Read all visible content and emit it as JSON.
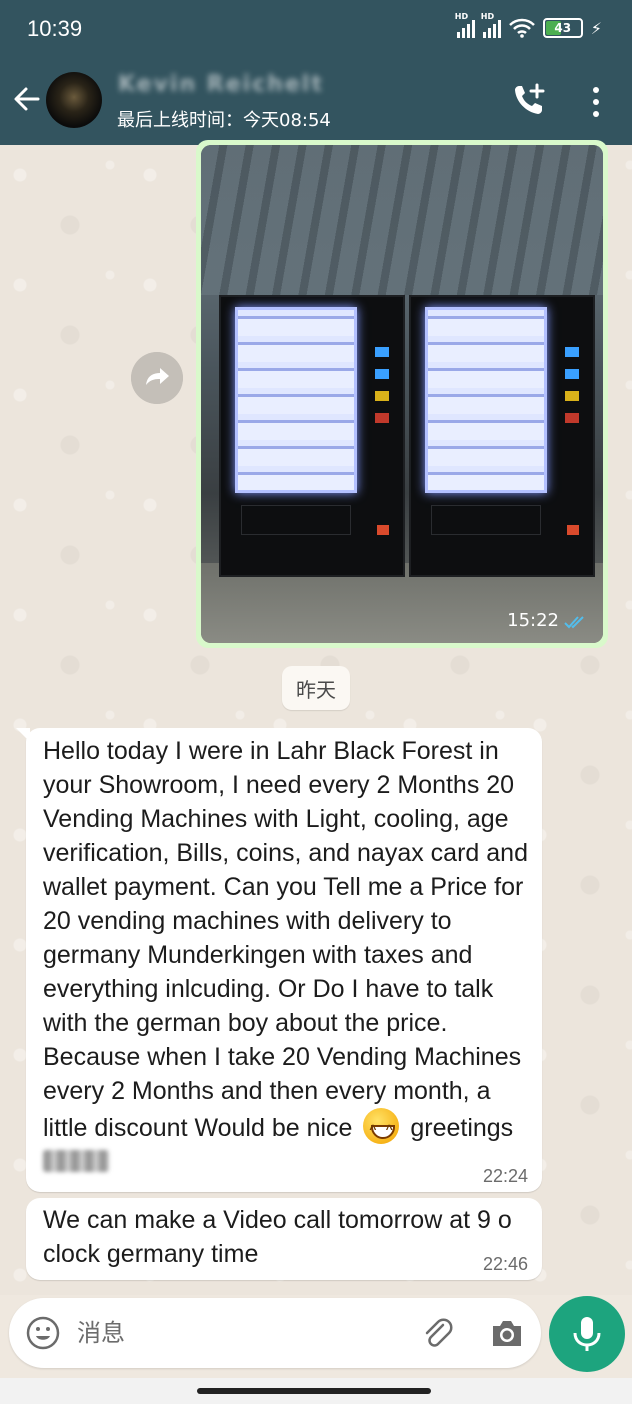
{
  "status_bar": {
    "time": "10:39",
    "signal_1_label": "HD",
    "signal_2_label": "HD",
    "battery_level": "43",
    "battery_fraction": 0.43
  },
  "header": {
    "contact_name": "Kevin Reichelt",
    "last_seen": "最后上线时间：今天08:54",
    "icons": [
      "back-arrow-icon",
      "add-call-icon",
      "more-vertical-icon"
    ]
  },
  "messages": {
    "image_message": {
      "time": "15:22",
      "status": "read"
    },
    "date_divider": "昨天",
    "message_1": {
      "text": "Hello today I were in Lahr Black Forest in your Showroom, I need every 2 Months 20 Vending Machines with Light, cooling, age verification, Bills, coins, and nayax card and wallet payment. Can you Tell me a Price for 20 vending machines with delivery to germany Munderkingen with taxes and everything inlcuding. Or Do I have to talk with the german boy about the price. Because when I take 20 Vending Machines every 2 Months and then every month, a little discount Would be nice",
      "after_emoji": " greetings ",
      "signature": "Kevin",
      "time": "22:24"
    },
    "message_2": {
      "text": "We can make a Video call tomorrow at 9 o clock germany time",
      "time": "22:46"
    }
  },
  "composer": {
    "placeholder": "消息",
    "value": ""
  },
  "colors": {
    "header_bg": "#33545f",
    "outgoing_bubble": "#d9f9cb",
    "incoming_bubble": "#ffffff",
    "accent_green": "#1da47e",
    "read_tick": "#53bdeb"
  }
}
